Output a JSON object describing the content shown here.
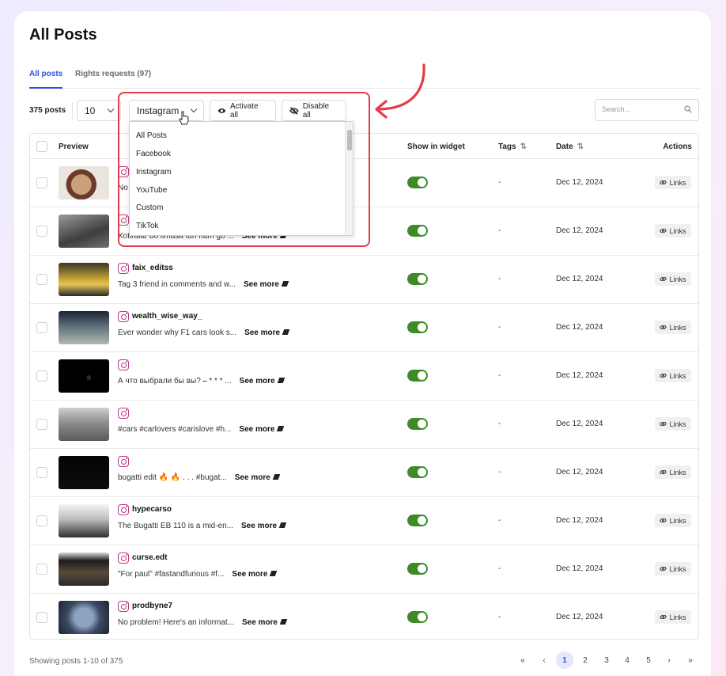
{
  "page": {
    "title": "All Posts"
  },
  "tabs": [
    {
      "label": "All posts",
      "active": true
    },
    {
      "label": "Rights requests (97)",
      "active": false
    }
  ],
  "toolbar": {
    "post_count": "375 posts",
    "per_page": "10",
    "source_filter": "Instagram",
    "activate_all": "Activate all",
    "disable_all": "Disable all",
    "search_placeholder": "Search..."
  },
  "dropdown": {
    "options": [
      "All Posts",
      "Facebook",
      "Instagram",
      "YouTube",
      "Custom",
      "TikTok"
    ]
  },
  "table": {
    "headers": {
      "preview": "Preview",
      "show_in_widget": "Show in widget",
      "tags": "Tags",
      "date": "Date",
      "actions": "Actions"
    },
    "see_more": "See more",
    "links_label": "Links",
    "rows": [
      {
        "username": "",
        "caption": "No",
        "tags": "-",
        "date": "Dec 12, 2024",
        "show": true
      },
      {
        "username": "",
        "caption": "Xotiralar bo limasa tun nam go ...",
        "tags": "-",
        "date": "Dec 12, 2024",
        "show": true
      },
      {
        "username": "faix_editss",
        "caption": "Tag 3 friend in comments and w...",
        "tags": "-",
        "date": "Dec 12, 2024",
        "show": true
      },
      {
        "username": "wealth_wise_way_",
        "caption": "Ever wonder why F1 cars look s...",
        "tags": "-",
        "date": "Dec 12, 2024",
        "show": true
      },
      {
        "username": "",
        "caption": "А что выбрали бы вы? ⎯ * * * ...",
        "tags": "-",
        "date": "Dec 12, 2024",
        "show": true
      },
      {
        "username": "",
        "caption": "#cars #carlovers #carislove #h...",
        "tags": "-",
        "date": "Dec 12, 2024",
        "show": true
      },
      {
        "username": "",
        "caption": "bugatti edit 🔥 🔥 . . . #bugat...",
        "tags": "-",
        "date": "Dec 12, 2024",
        "show": true
      },
      {
        "username": "hypecarso",
        "caption": "The Bugatti EB 110 is a mid-en...",
        "tags": "-",
        "date": "Dec 12, 2024",
        "show": true
      },
      {
        "username": "curse.edt",
        "caption": "\"For paul\" #fastandfurious #f...",
        "tags": "-",
        "date": "Dec 12, 2024",
        "show": true
      },
      {
        "username": "prodbyne7",
        "caption": "No problem! Here's an informat...",
        "tags": "-",
        "date": "Dec 12, 2024",
        "show": true
      }
    ]
  },
  "footer": {
    "showing": "Showing posts 1-10 of 375",
    "pages": [
      "1",
      "2",
      "3",
      "4",
      "5"
    ],
    "current_page": "1",
    "first_icon": "«",
    "prev_icon": "‹",
    "next_icon": "›",
    "last_icon": "»"
  },
  "colors": {
    "accent": "#2f4ee6",
    "toggle_on": "#3d8b27",
    "highlight": "#e53b47",
    "instagram": "#c1358a"
  }
}
